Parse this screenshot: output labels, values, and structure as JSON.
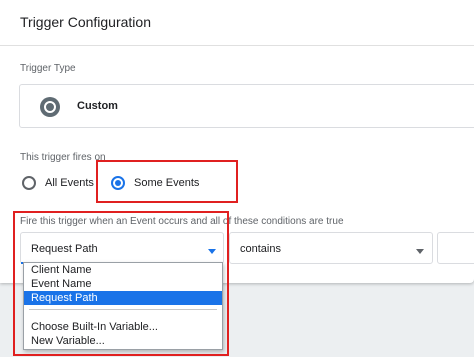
{
  "header": {
    "title": "Trigger Configuration"
  },
  "trigger_type": {
    "label": "Trigger Type",
    "value": "Custom",
    "icon": "custom-event-icon"
  },
  "fires_on": {
    "label": "This trigger fires on",
    "options": [
      {
        "label": "All Events",
        "checked": false
      },
      {
        "label": "Some Events",
        "checked": true
      }
    ]
  },
  "condition": {
    "label": "Fire this trigger when an Event occurs and all of these conditions are true",
    "variable": "Request Path",
    "operator": "contains",
    "value": ""
  },
  "dropdown": {
    "items": [
      "Client Name",
      "Event Name",
      "Request Path"
    ],
    "selected": "Request Path",
    "actions": [
      "Choose Built-In Variable...",
      "New Variable..."
    ]
  },
  "colors": {
    "accent": "#1a73e8",
    "highlight": "#e02020"
  }
}
